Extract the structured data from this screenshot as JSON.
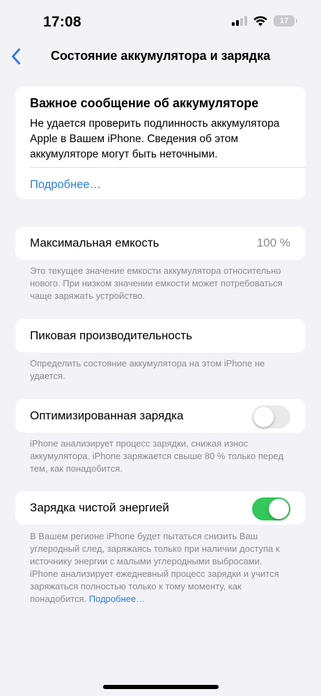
{
  "status_bar": {
    "time": "17:08",
    "battery_level": "17",
    "icons": [
      "cellular-signal-icon",
      "wifi-icon",
      "battery-icon"
    ]
  },
  "nav": {
    "back_icon": "chevron-left-icon",
    "title": "Состояние аккумулятора и зарядка"
  },
  "alert": {
    "title": "Важное сообщение об аккумуляторе",
    "body": "Не удается проверить подлинность аккумулятора Apple в Вашем iPhone. Сведения об этом аккумуляторе могут быть неточными.",
    "link": "Подробнее…"
  },
  "max_capacity": {
    "label": "Максимальная емкость",
    "value": "100 %",
    "footnote": "Это текущее значение емкости аккумулятора относительно нового. При низком значении емкости может потребоваться чаще заряжать устройство."
  },
  "peak_performance": {
    "label": "Пиковая производительность",
    "footnote": "Определить состояние аккумулятора на этом iPhone не удается."
  },
  "optimized_charging": {
    "label": "Оптимизированная зарядка",
    "enabled": false,
    "footnote": "iPhone анализирует процесс зарядки, снижая износ аккумулятора. iPhone заряжается свыше 80 % только перед тем, как понадобится."
  },
  "clean_energy": {
    "label": "Зарядка чистой энергией",
    "enabled": true,
    "footnote": "В Вашем регионе iPhone будет пытаться снизить Ваш углеродный след, заряжаясь только при наличии доступа к источнику энергии с малыми углеродными выбросами. iPhone анализирует ежедневный процесс зарядки и учится заряжаться полностью только к тому моменту, как понадобится.",
    "link": "Подробнее…"
  },
  "colors": {
    "accent": "#2c7ee0",
    "toggle_on": "#34c759",
    "toggle_off": "#e9e9ea",
    "background": "#f2f2f7",
    "secondary_text": "#8a8a8e"
  }
}
